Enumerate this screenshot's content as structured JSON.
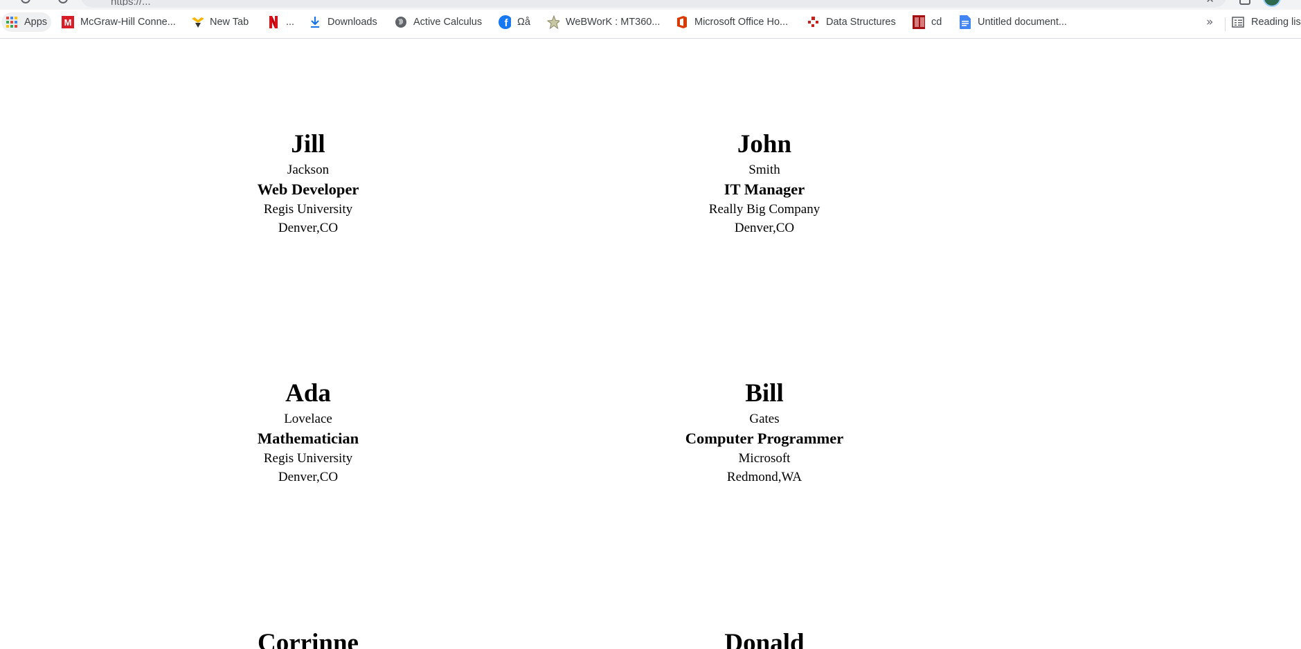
{
  "browser": {
    "url_text": "https://...",
    "bookmarks": [
      {
        "label": "Apps",
        "icon": "apps-grid-icon"
      },
      {
        "label": "McGraw-Hill Conne...",
        "icon": "mcgraw-hill-icon",
        "color": "#d71e28"
      },
      {
        "label": "New Tab",
        "icon": "new-tab-icon",
        "color": "#f4b400"
      },
      {
        "label": "...",
        "icon": "netflix-icon",
        "color": "#e50914"
      },
      {
        "label": "Downloads",
        "icon": "download-icon",
        "color": "#1a73e8"
      },
      {
        "label": "Active Calculus",
        "icon": "globe-icon",
        "color": "#5f6368"
      },
      {
        "label": "Ωå",
        "icon": "facebook-icon",
        "color": "#1877f2"
      },
      {
        "label": "WeBWorK : MT360...",
        "icon": "webwork-star-icon",
        "color": "#9e9e7a"
      },
      {
        "label": "Microsoft Office Ho...",
        "icon": "office-icon",
        "color": "#d83b01"
      },
      {
        "label": "Data Structures",
        "icon": "data-structures-icon",
        "color": "#c5221f"
      },
      {
        "label": "cd",
        "icon": "cd-book-icon",
        "color": "#a50e0e"
      },
      {
        "label": "Untitled document...",
        "icon": "google-docs-icon",
        "color": "#4285f4"
      }
    ],
    "overflow_label": "»",
    "reading_list_label": "Reading list"
  },
  "people": [
    {
      "first": "Jill",
      "last": "Jackson",
      "title": "Web Developer",
      "org": "Regis University",
      "location": "Denver,CO"
    },
    {
      "first": "John",
      "last": "Smith",
      "title": "IT Manager",
      "org": "Really Big Company",
      "location": "Denver,CO"
    },
    {
      "first": "Ada",
      "last": "Lovelace",
      "title": "Mathematician",
      "org": "Regis University",
      "location": "Denver,CO"
    },
    {
      "first": "Bill",
      "last": "Gates",
      "title": "Computer Programmer",
      "org": "Microsoft",
      "location": "Redmond,WA"
    },
    {
      "first": "Corrinne"
    },
    {
      "first": "Donald"
    }
  ]
}
